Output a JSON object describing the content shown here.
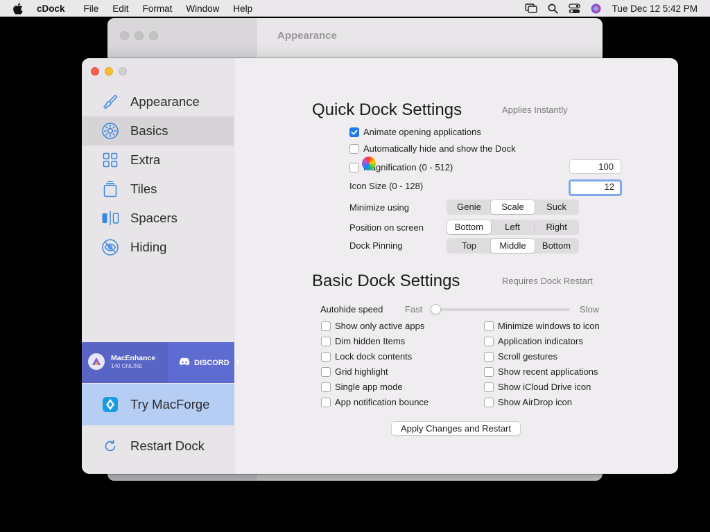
{
  "menubar": {
    "app_name": "cDock",
    "items": [
      "File",
      "Edit",
      "Format",
      "Window",
      "Help"
    ],
    "clock": "Tue Dec 12  5:42 PM"
  },
  "background_window": {
    "title": "Appearance"
  },
  "sidebar": {
    "items": [
      {
        "label": "Appearance",
        "icon": "paintbrush-icon"
      },
      {
        "label": "Basics",
        "icon": "gear-icon"
      },
      {
        "label": "Extra",
        "icon": "grid-icon"
      },
      {
        "label": "Tiles",
        "icon": "tiles-icon"
      },
      {
        "label": "Spacers",
        "icon": "spacer-icon"
      },
      {
        "label": "Hiding",
        "icon": "hidden-eye-icon"
      }
    ],
    "selected": "Basics",
    "banner": {
      "name": "MacEnhance",
      "online": "140 ONLINE",
      "discord": "DISCORD"
    },
    "try_macforge": "Try MacForge",
    "restart_dock": "Restart Dock"
  },
  "quick": {
    "title": "Quick Dock Settings",
    "note": "Applies Instantly",
    "animate_label": "Animate opening applications",
    "animate_checked": true,
    "autohide_label": "Automatically hide and show the Dock",
    "autohide_checked": false,
    "magnification_label": "Magnification (0 - 512)",
    "magnification_checked": false,
    "magnification_value": "100",
    "icon_size_label": "Icon Size (0 - 128)",
    "icon_size_value": "12",
    "minimize_label": "Minimize using",
    "minimize_options": [
      "Genie",
      "Scale",
      "Suck"
    ],
    "minimize_selected": "Scale",
    "position_label": "Position on screen",
    "position_options": [
      "Bottom",
      "Left",
      "Right"
    ],
    "position_selected": "Bottom",
    "pinning_label": "Dock Pinning",
    "pinning_options": [
      "Top",
      "Middle",
      "Bottom"
    ],
    "pinning_selected": "Middle"
  },
  "basic": {
    "title": "Basic Dock Settings",
    "note": "Requires Dock Restart",
    "autohide_speed_label": "Autohide speed",
    "fast_label": "Fast",
    "slow_label": "Slow",
    "autohide_speed_value": 0.0,
    "left_options": [
      "Show only active apps",
      "Dim hidden Items",
      "Lock dock contents",
      "Grid highlight",
      "Single app mode",
      "App notification bounce"
    ],
    "right_options": [
      "Minimize windows to icon",
      "Application indicators",
      "Scroll gestures",
      "Show recent applications",
      "Show iCloud Drive icon",
      "Show AirDrop icon"
    ],
    "apply_button": "Apply Changes and Restart"
  },
  "colors": {
    "accent": "#1f7cf2",
    "selected_nav": "#d6d4d6",
    "try_macforge_bg": "#b6cdf4",
    "discord_banner": "#5865c4"
  }
}
